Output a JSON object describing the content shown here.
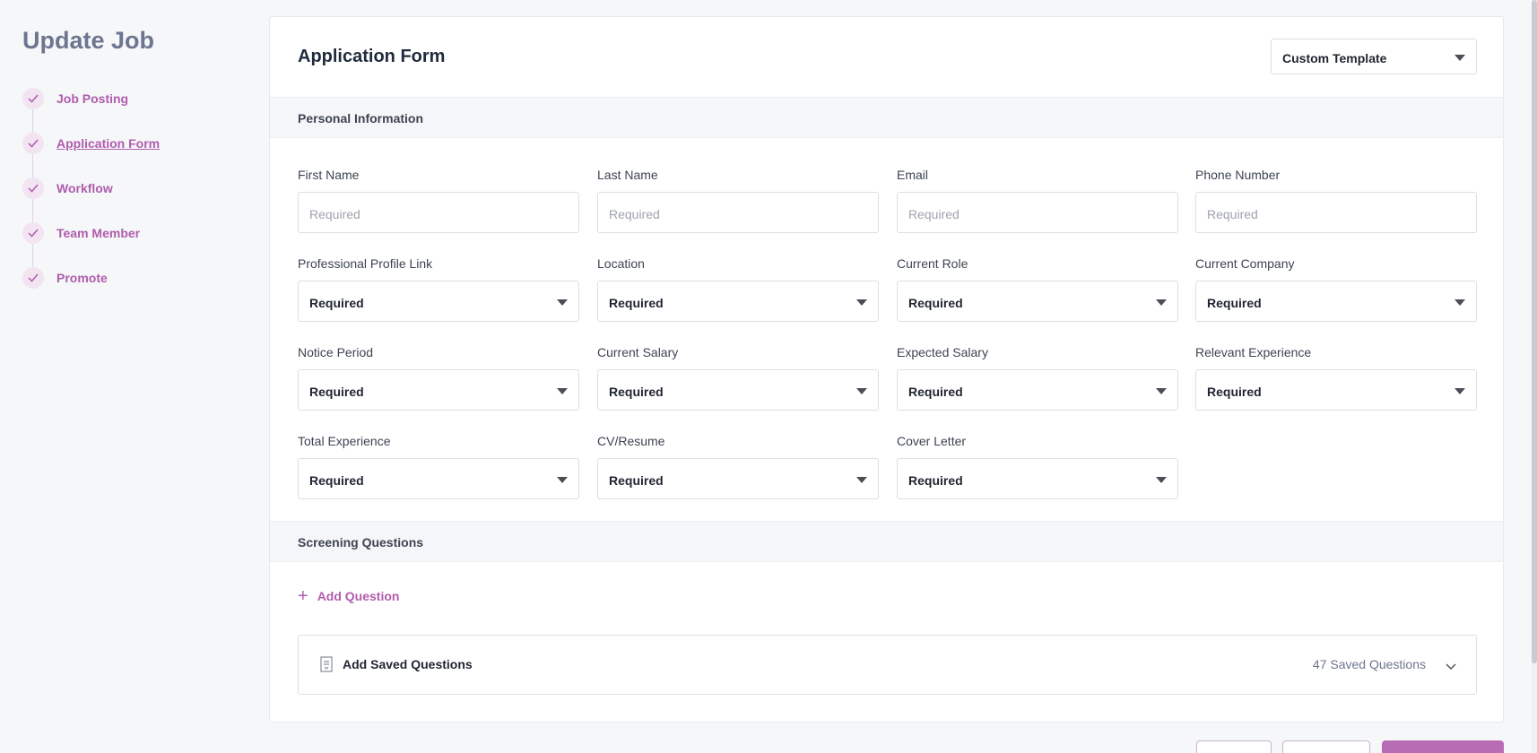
{
  "page_title": "Update Job",
  "steps": [
    {
      "label": "Job Posting",
      "active": false
    },
    {
      "label": "Application Form",
      "active": true
    },
    {
      "label": "Workflow",
      "active": false
    },
    {
      "label": "Team Member",
      "active": false
    },
    {
      "label": "Promote",
      "active": false
    }
  ],
  "form": {
    "title": "Application Form",
    "template_select": "Custom Template",
    "personal_section": "Personal Information",
    "screening_section": "Screening Questions",
    "fields": {
      "first_name": {
        "label": "First Name",
        "placeholder": "Required"
      },
      "last_name": {
        "label": "Last Name",
        "placeholder": "Required"
      },
      "email": {
        "label": "Email",
        "placeholder": "Required"
      },
      "phone_number": {
        "label": "Phone Number",
        "placeholder": "Required"
      },
      "professional_profile_link": {
        "label": "Professional Profile Link",
        "value": "Required"
      },
      "location": {
        "label": "Location",
        "value": "Required"
      },
      "current_role": {
        "label": "Current Role",
        "value": "Required"
      },
      "current_company": {
        "label": "Current Company",
        "value": "Required"
      },
      "notice_period": {
        "label": "Notice Period",
        "value": "Required"
      },
      "current_salary": {
        "label": "Current Salary",
        "value": "Required"
      },
      "expected_salary": {
        "label": "Expected Salary",
        "value": "Required"
      },
      "relevant_experience": {
        "label": "Relevant Experience",
        "value": "Required"
      },
      "total_experience": {
        "label": "Total Experience",
        "value": "Required"
      },
      "cv_resume": {
        "label": "CV/Resume",
        "value": "Required"
      },
      "cover_letter": {
        "label": "Cover Letter",
        "value": "Required"
      }
    },
    "add_question": "Add Question",
    "saved_questions": {
      "title": "Add Saved Questions",
      "count_label": "47 Saved Questions"
    }
  },
  "colors": {
    "accent": "#b05cad",
    "accent_light": "#f3e4f2",
    "background": "#f5f7f9"
  }
}
